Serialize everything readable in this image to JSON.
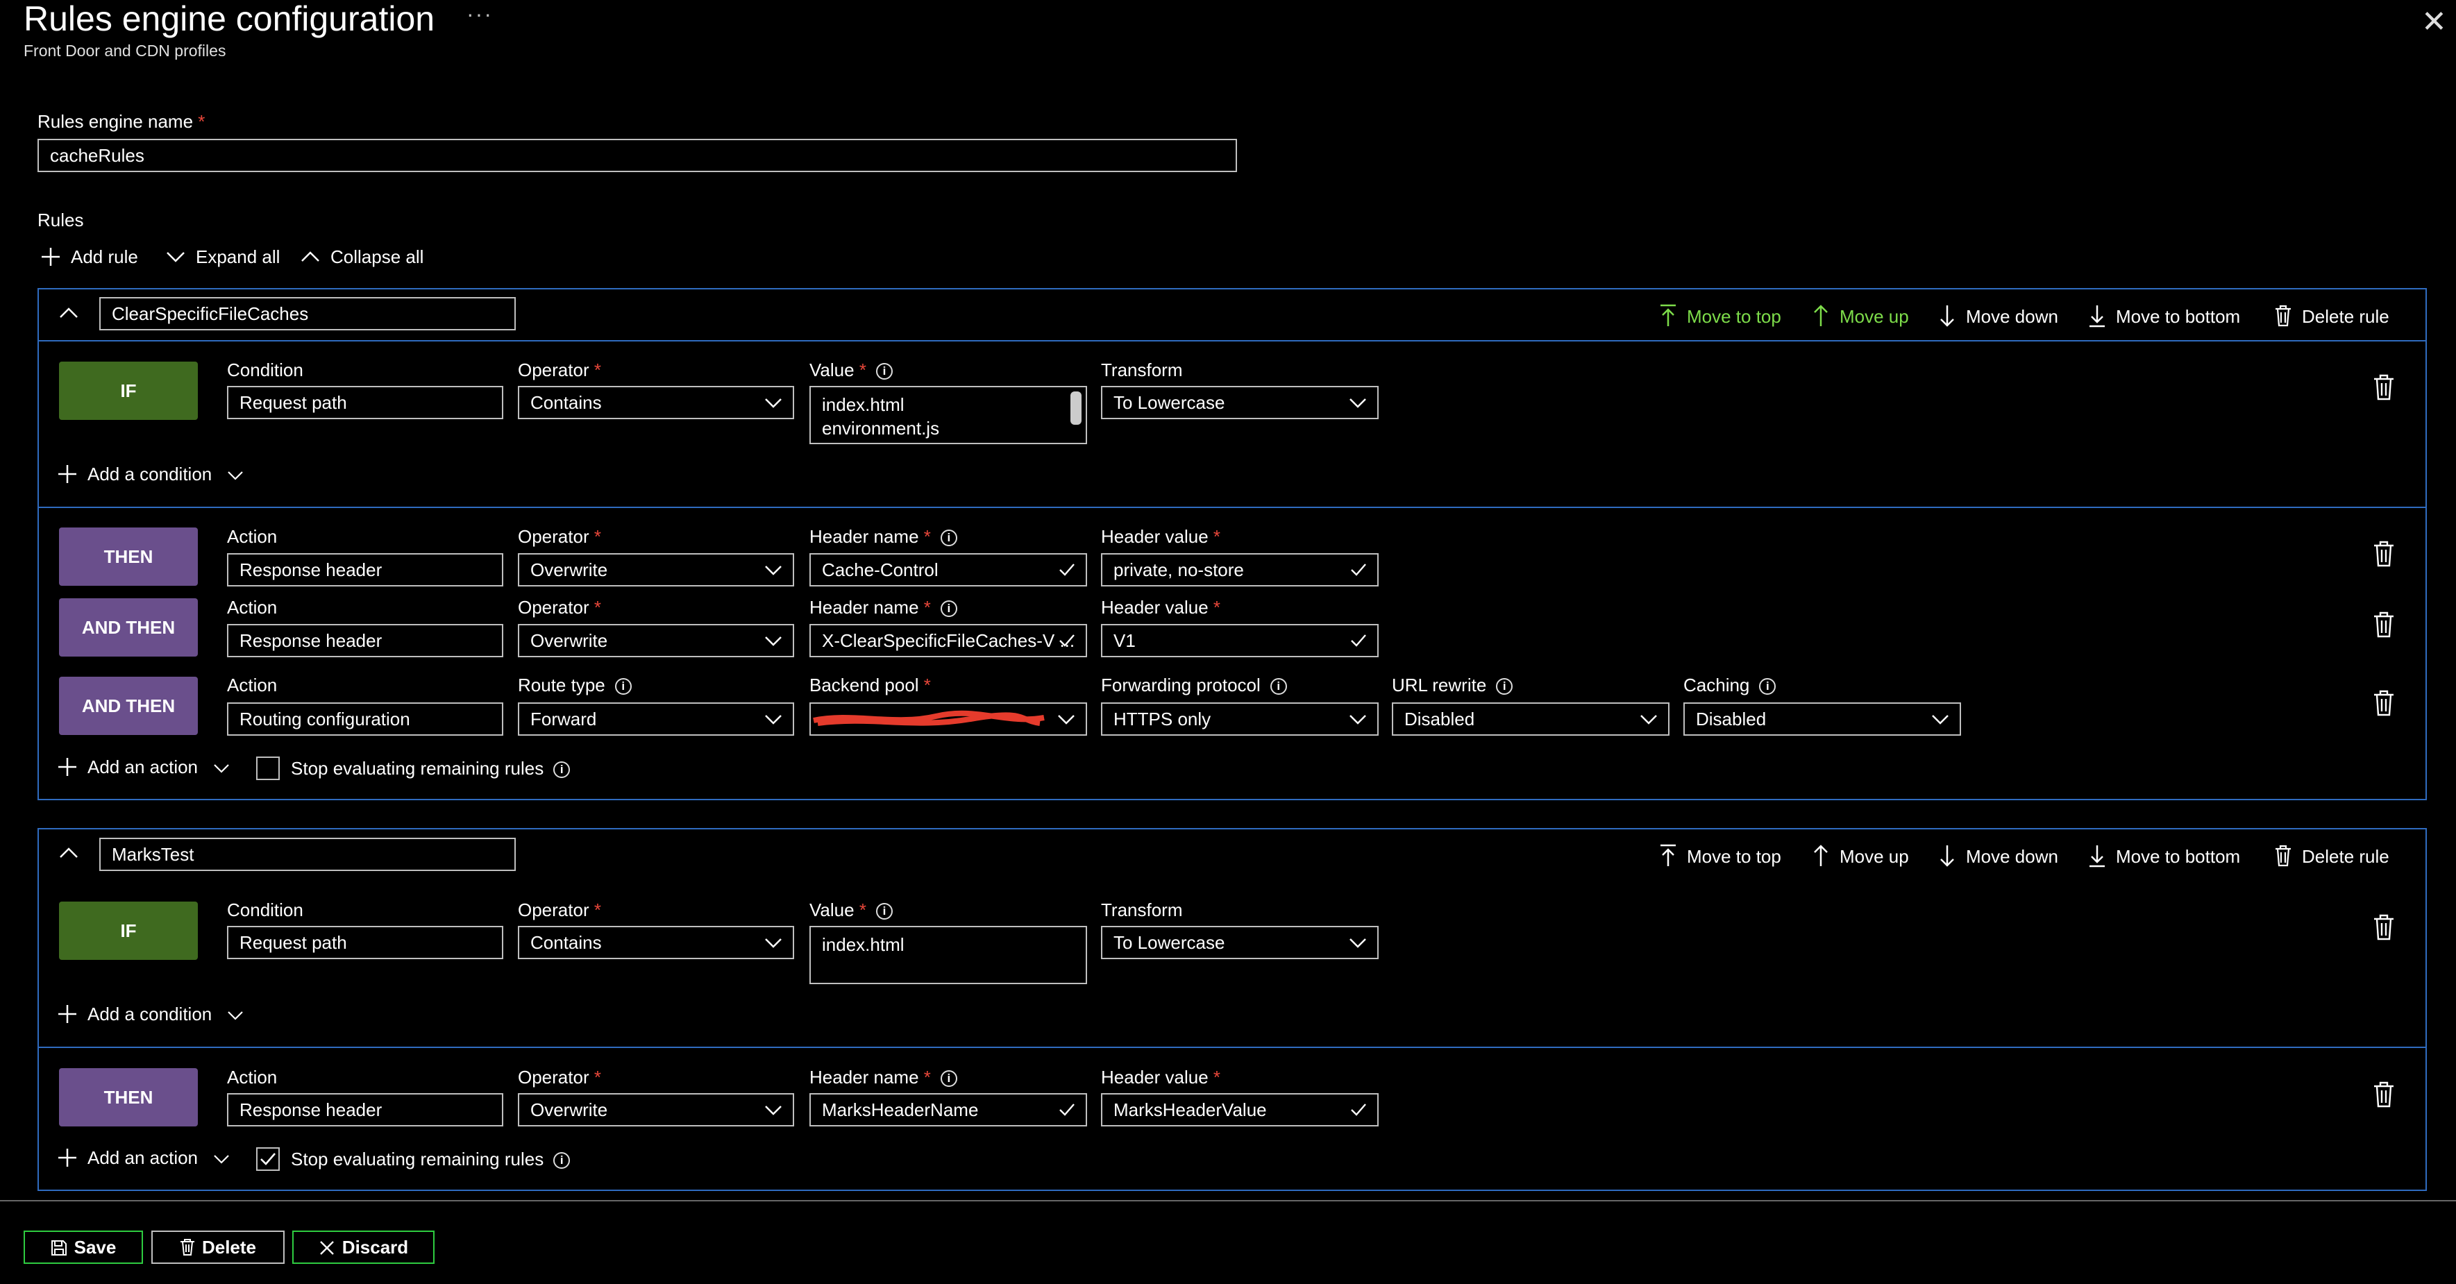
{
  "header": {
    "title": "Rules engine configuration",
    "more": "···",
    "subtitle": "Front Door and CDN profiles",
    "close": "✕"
  },
  "engine_name": {
    "label": "Rules engine name",
    "required": "*",
    "value": "cacheRules"
  },
  "rules_section": {
    "label": "Rules"
  },
  "toolbar": {
    "add_rule": "Add rule",
    "expand_all": "Expand all",
    "collapse_all": "Collapse all"
  },
  "rule_actions": {
    "move_top": "Move to top",
    "move_up": "Move up",
    "move_down": "Move down",
    "move_bottom": "Move to bottom",
    "delete": "Delete rule"
  },
  "rules": [
    {
      "name": "ClearSpecificFileCaches",
      "if": {
        "badge": "IF",
        "condition_label": "Condition",
        "condition_value": "Request path",
        "operator_label": "Operator",
        "operator_value": "Contains",
        "value_label": "Value",
        "value_lines": [
          "index.html",
          "environment.js"
        ],
        "transform_label": "Transform",
        "transform_value": "To Lowercase"
      },
      "add_condition": "Add a condition",
      "actions": [
        {
          "badge": "THEN",
          "action_label": "Action",
          "action_value": "Response header",
          "operator_label": "Operator",
          "operator_value": "Overwrite",
          "f3_label": "Header name",
          "f3_value": "Cache-Control",
          "f4_label": "Header value",
          "f4_value": "private, no-store"
        },
        {
          "badge": "AND THEN",
          "action_label": "Action",
          "action_value": "Response header",
          "operator_label": "Operator",
          "operator_value": "Overwrite",
          "f3_label": "Header name",
          "f3_value": "X-ClearSpecificFileCaches-V ...",
          "f4_label": "Header value",
          "f4_value": "V1"
        },
        {
          "badge": "AND THEN",
          "action_label": "Action",
          "action_value": "Routing configuration",
          "operator_label": "Route type",
          "operator_value": "Forward",
          "f3_label": "Backend pool",
          "f3_value": "",
          "f4_label": "Forwarding protocol",
          "f4_value": "HTTPS only",
          "f5_label": "URL rewrite",
          "f5_value": "Disabled",
          "f6_label": "Caching",
          "f6_value": "Disabled"
        }
      ],
      "add_action": "Add an action",
      "stop_label": "Stop evaluating remaining rules",
      "stop_checked": false
    },
    {
      "name": "MarksTest",
      "if": {
        "badge": "IF",
        "condition_label": "Condition",
        "condition_value": "Request path",
        "operator_label": "Operator",
        "operator_value": "Contains",
        "value_label": "Value",
        "value_lines": [
          "index.html"
        ],
        "transform_label": "Transform",
        "transform_value": "To Lowercase"
      },
      "add_condition": "Add a condition",
      "actions": [
        {
          "badge": "THEN",
          "action_label": "Action",
          "action_value": "Response header",
          "operator_label": "Operator",
          "operator_value": "Overwrite",
          "f3_label": "Header name",
          "f3_value": "MarksHeaderName",
          "f4_label": "Header value",
          "f4_value": "MarksHeaderValue"
        }
      ],
      "add_action": "Add an action",
      "stop_label": "Stop evaluating remaining rules",
      "stop_checked": true
    }
  ],
  "footer": {
    "save": "Save",
    "delete": "Delete",
    "discard": "Discard"
  },
  "colors": {
    "accent_green": "#7ddc4a",
    "rule_border": "#2f6bbf",
    "if_badge": "#3f6a1f",
    "then_badge": "#6a4f8c",
    "required": "#e8473a",
    "redaction": "#e53b2c"
  }
}
